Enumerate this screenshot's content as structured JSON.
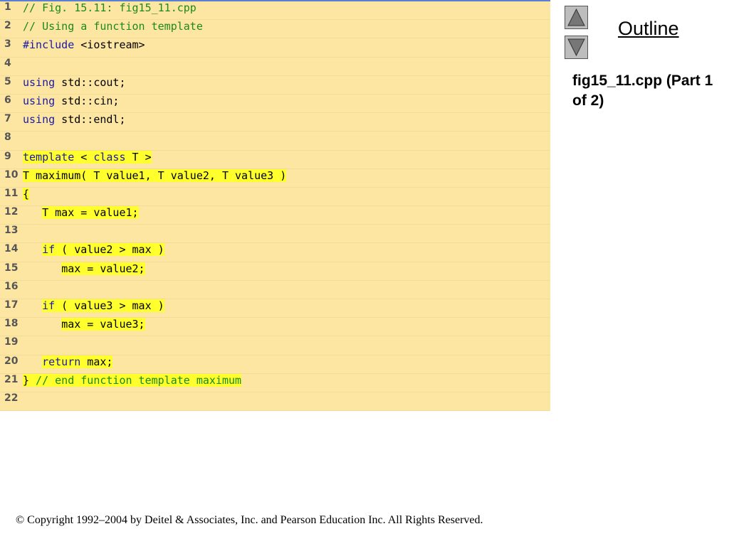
{
  "code": {
    "lines": [
      {
        "n": "1",
        "hl": false,
        "tokens": [
          {
            "t": "// Fig. 15.11: fig15_11.cpp",
            "c": "comment"
          }
        ]
      },
      {
        "n": "2",
        "hl": false,
        "tokens": [
          {
            "t": "// Using a function template",
            "c": "comment"
          }
        ]
      },
      {
        "n": "3",
        "hl": false,
        "tokens": [
          {
            "t": "#include",
            "c": "keyword"
          },
          {
            "t": " <iostream>",
            "c": "plain"
          }
        ]
      },
      {
        "n": "4",
        "hl": false,
        "tokens": []
      },
      {
        "n": "5",
        "hl": false,
        "tokens": [
          {
            "t": "using",
            "c": "keyword"
          },
          {
            "t": " std::cout;",
            "c": "plain"
          }
        ]
      },
      {
        "n": "6",
        "hl": false,
        "tokens": [
          {
            "t": "using",
            "c": "keyword"
          },
          {
            "t": " std::cin;",
            "c": "plain"
          }
        ]
      },
      {
        "n": "7",
        "hl": false,
        "tokens": [
          {
            "t": "using",
            "c": "keyword"
          },
          {
            "t": " std::endl;",
            "c": "plain"
          }
        ]
      },
      {
        "n": "8",
        "hl": false,
        "tokens": []
      },
      {
        "n": "9",
        "hl": true,
        "tokens": [
          {
            "t": "template",
            "c": "keyword"
          },
          {
            "t": " < ",
            "c": "plain"
          },
          {
            "t": "class",
            "c": "keyword"
          },
          {
            "t": " T >",
            "c": "plain"
          }
        ]
      },
      {
        "n": "10",
        "hl": true,
        "tokens": [
          {
            "t": "T maximum( T value1, T value2, T value3 )",
            "c": "plain"
          }
        ]
      },
      {
        "n": "11",
        "hl": true,
        "tokens": [
          {
            "t": "{",
            "c": "plain"
          }
        ]
      },
      {
        "n": "12",
        "hl": true,
        "indent": "   ",
        "tokens": [
          {
            "t": "T max = value1;",
            "c": "plain"
          }
        ]
      },
      {
        "n": "13",
        "hl": false,
        "tokens": []
      },
      {
        "n": "14",
        "hl": true,
        "indent": "   ",
        "tokens": [
          {
            "t": "if",
            "c": "keyword"
          },
          {
            "t": " ( value2 > max )",
            "c": "plain"
          }
        ]
      },
      {
        "n": "15",
        "hl": true,
        "indent": "      ",
        "tokens": [
          {
            "t": "max = value2;",
            "c": "plain"
          }
        ]
      },
      {
        "n": "16",
        "hl": false,
        "tokens": []
      },
      {
        "n": "17",
        "hl": true,
        "indent": "   ",
        "tokens": [
          {
            "t": "if",
            "c": "keyword"
          },
          {
            "t": " ( value3 > max )",
            "c": "plain"
          }
        ]
      },
      {
        "n": "18",
        "hl": true,
        "indent": "      ",
        "tokens": [
          {
            "t": "max = value3;",
            "c": "plain"
          }
        ]
      },
      {
        "n": "19",
        "hl": false,
        "tokens": []
      },
      {
        "n": "20",
        "hl": true,
        "indent": "   ",
        "tokens": [
          {
            "t": "return",
            "c": "keyword"
          },
          {
            "t": " max;",
            "c": "plain"
          }
        ]
      },
      {
        "n": "21",
        "hl": true,
        "tokens": [
          {
            "t": "}",
            "c": "plain"
          },
          {
            "t": " // end function template maximum",
            "c": "comment"
          }
        ]
      },
      {
        "n": "22",
        "hl": false,
        "tokens": []
      }
    ]
  },
  "sidebar": {
    "outline_label": "Outline",
    "up_icon": "triangle-up-icon",
    "down_icon": "triangle-down-icon",
    "file_caption": "fig15_11.cpp (Part 1 of 2)"
  },
  "footer": {
    "copyright": "© Copyright 1992–2004 by Deitel & Associates, Inc. and Pearson Education Inc. All Rights Reserved."
  }
}
